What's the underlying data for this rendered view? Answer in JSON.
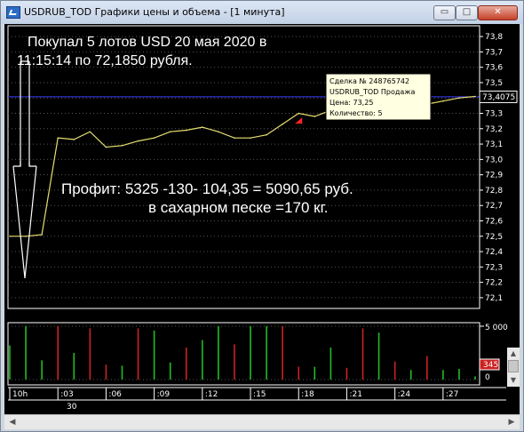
{
  "window": {
    "title": "USDRUB_TOD Графики цены и объема - [1 минута]",
    "btn_min": "▭",
    "btn_max": "□",
    "btn_close": "✕"
  },
  "annotations": {
    "line1": "Покупал 5 лотов USD 20 мая  2020 в",
    "line2": "11:15:14  по 72,1850 рубля.",
    "profit": "Профит:  5325 -130- 104,35 = 5090,65 руб.",
    "sugar": "в сахарном песке =170 кг."
  },
  "tooltip": {
    "line1": "Сделка № 248765742",
    "line2": "USDRUB_TOD Продажа",
    "line3": "Цена: 73,25",
    "line4": "Количество: 5"
  },
  "current_price_label": "73,4075",
  "volume_axis": {
    "top_label": "5 000",
    "current_volume_label": "345",
    "zero_label": "0"
  },
  "time_axis": {
    "day_label": "30",
    "labels": [
      "10h",
      ":03",
      ":06",
      ":09",
      ":12",
      ":15",
      ":18",
      ":21",
      ":24",
      ":27"
    ]
  },
  "colors": {
    "price_line": "#e8e070",
    "current_price_line": "#3a3aff",
    "volume_up": "#22bb22",
    "volume_down": "#cc2222",
    "tooltip_bg": "#ffffe1",
    "trade_marker": "#ff2222"
  },
  "chart_data": [
    {
      "type": "line",
      "series": [
        {
          "x": [
            "10:00",
            "10:01",
            "10:02",
            "10:03",
            "10:04",
            "10:05",
            "10:06",
            "10:07",
            "10:08",
            "10:09",
            "10:10",
            "10:11",
            "10:12",
            "10:13",
            "10:14",
            "10:15",
            "10:16",
            "10:17",
            "10:18",
            "10:19",
            "10:20",
            "10:21",
            "10:22",
            "10:23",
            "10:24",
            "10:25",
            "10:26",
            "10:27",
            "10:28",
            "10:29"
          ],
          "values": [
            72.5,
            72.5,
            72.51,
            73.14,
            73.13,
            73.18,
            73.08,
            73.09,
            73.12,
            73.14,
            73.18,
            73.19,
            73.21,
            73.18,
            73.14,
            73.14,
            73.16,
            73.23,
            73.3,
            73.28,
            73.32,
            73.32,
            73.33,
            73.35,
            73.34,
            73.35,
            73.36,
            73.38,
            73.4,
            73.41
          ]
        }
      ],
      "y_ticks": [
        "73,8",
        "73,7",
        "73,6",
        "73,5",
        "73,4",
        "73,3",
        "73,2",
        "73,1",
        "73,0",
        "72,9",
        "72,8",
        "72,7",
        "72,6",
        "72,5",
        "72,4",
        "72,3",
        "72,2",
        "72,1"
      ],
      "ylim": [
        72.03,
        73.87
      ],
      "current_price": 73.4075,
      "trade_marker": {
        "x": "10:18",
        "y": 73.25
      }
    },
    {
      "type": "bar",
      "categories": [
        "10:00",
        "10:01",
        "10:02",
        "10:03",
        "10:04",
        "10:05",
        "10:06",
        "10:07",
        "10:08",
        "10:09",
        "10:10",
        "10:11",
        "10:12",
        "10:13",
        "10:14",
        "10:15",
        "10:16",
        "10:17",
        "10:18",
        "10:19",
        "10:20",
        "10:21",
        "10:22",
        "10:23",
        "10:24",
        "10:25",
        "10:26",
        "10:27",
        "10:28",
        "10:29"
      ],
      "values": [
        3200,
        5000,
        1800,
        5000,
        2500,
        4800,
        1400,
        1300,
        4800,
        4600,
        1600,
        3000,
        3700,
        5000,
        3300,
        5000,
        5000,
        5000,
        1200,
        1200,
        3000,
        1100,
        4800,
        4400,
        1700,
        900,
        2200,
        900,
        1000,
        300
      ],
      "up": [
        true,
        true,
        true,
        false,
        true,
        false,
        false,
        true,
        false,
        true,
        true,
        false,
        true,
        true,
        false,
        true,
        true,
        false,
        false,
        true,
        true,
        false,
        false,
        true,
        false,
        true,
        false,
        true,
        true,
        true
      ],
      "ylim": [
        0,
        5000
      ]
    }
  ]
}
